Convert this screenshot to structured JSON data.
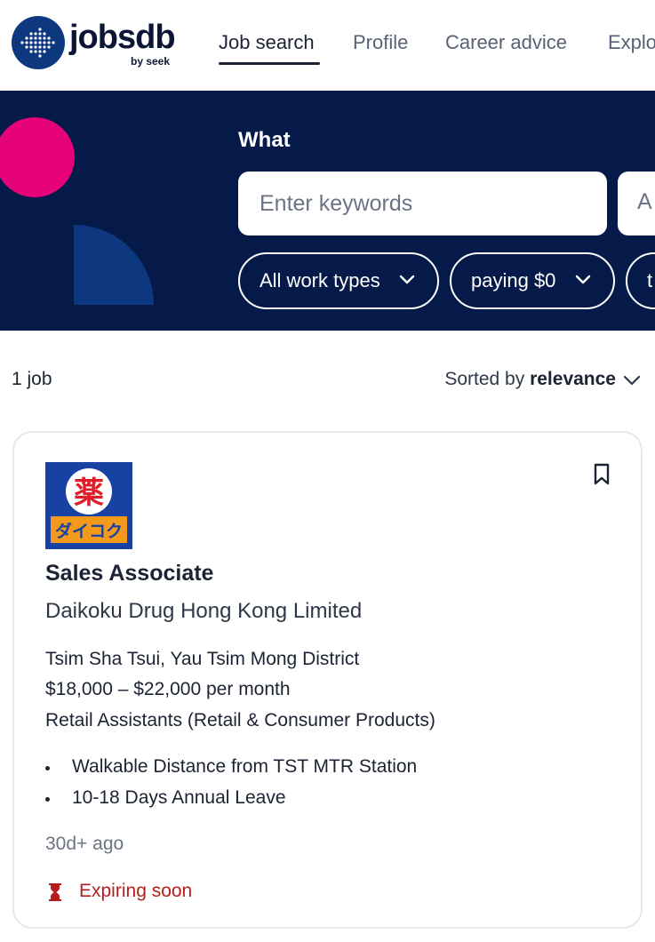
{
  "brand": {
    "name": "jobsdb",
    "tagline": "by seek"
  },
  "nav": {
    "items": [
      {
        "label": "Job search",
        "active": true
      },
      {
        "label": "Profile",
        "active": false
      },
      {
        "label": "Career advice",
        "active": false
      },
      {
        "label": "Explo",
        "active": false
      }
    ]
  },
  "search": {
    "what_label": "What",
    "keywords_placeholder": "Enter keywords",
    "where_placeholder": "A",
    "filters": [
      {
        "label": "All work types",
        "icon": "chevron-down-icon"
      },
      {
        "label": "paying $0",
        "icon": "chevron-down-icon"
      },
      {
        "label": "t",
        "icon": ""
      }
    ]
  },
  "results": {
    "count_label": "1 job",
    "sort_prefix": "Sorted by",
    "sort_value": "relevance"
  },
  "job": {
    "title": "Sales Associate",
    "company": "Daikoku Drug Hong Kong Limited",
    "location": "Tsim Sha Tsui, Yau Tsim Mong District",
    "salary": "$18,000 – $22,000 per month",
    "classification": "Retail Assistants  (Retail & Consumer Products)",
    "highlights": [
      "Walkable Distance from TST MTR Station",
      "10-18 Days Annual Leave"
    ],
    "posted": "30d+ ago",
    "expiring": "Expiring soon",
    "logo": {
      "kanji": "薬",
      "katakana": "ダイコク"
    }
  },
  "colors": {
    "banner": "#051a49",
    "brand_blue": "#0d3880",
    "accent_pink": "#e60278",
    "expiring_red": "#b91c1c"
  }
}
